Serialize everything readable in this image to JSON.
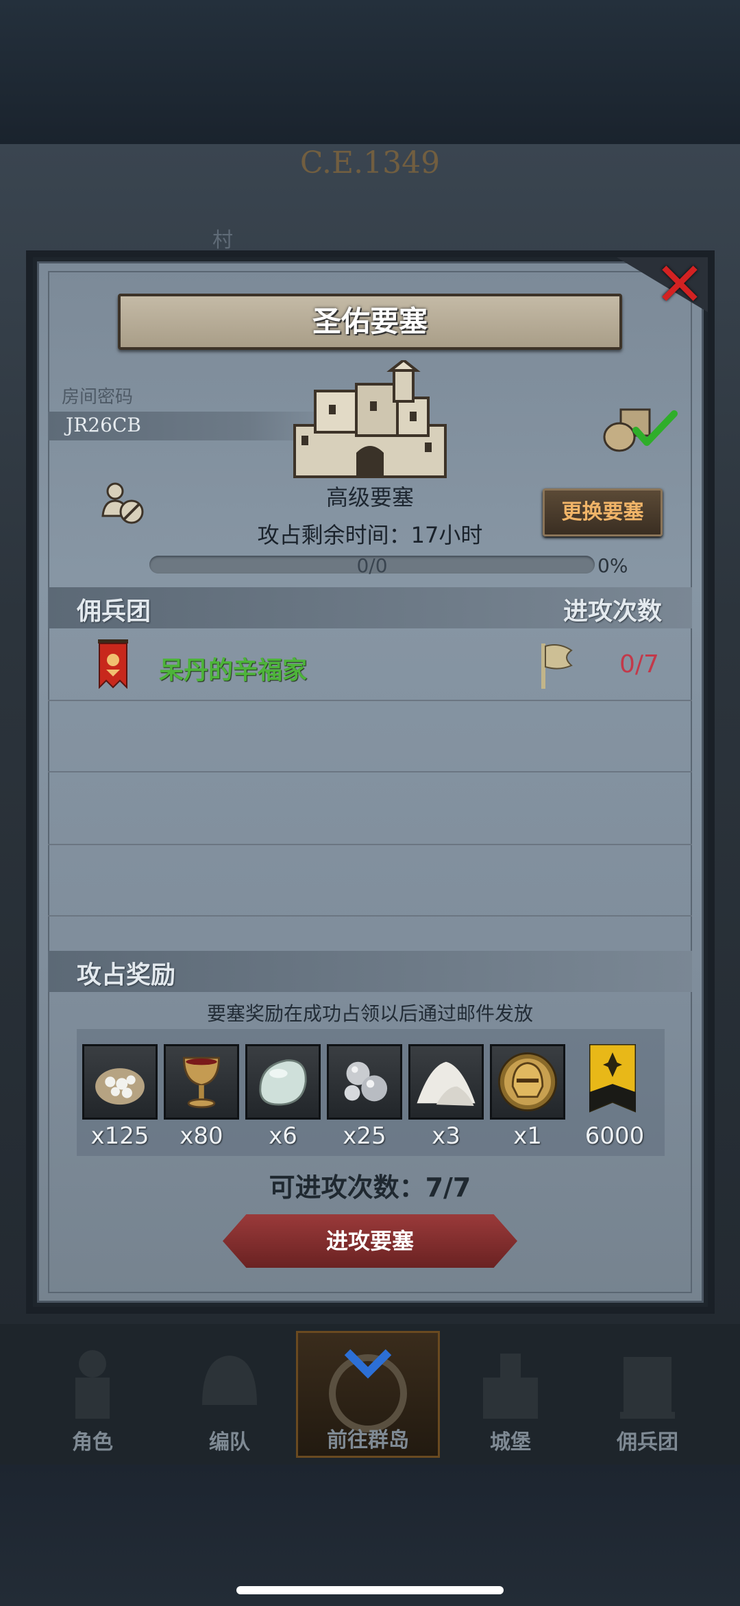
{
  "background": {
    "year": "C.E.1349",
    "village": "村"
  },
  "dialog": {
    "title": "圣佑要塞",
    "room_label": "房间密码",
    "room_code": "JR26CB",
    "fortress_type": "高级要塞",
    "timer_label": "攻占剩余时间：17小时",
    "change_button": "更换要塞",
    "progress_text": "0/0",
    "progress_percent": "0%",
    "progress_value": 0
  },
  "mercenary": {
    "header_left": "佣兵团",
    "header_right": "进攻次数",
    "rows": [
      {
        "name": "呆丹的辛福家",
        "attacks": "0/7"
      }
    ]
  },
  "rewards": {
    "header": "攻占奖励",
    "note": "要塞奖励在成功占领以后通过邮件发放",
    "items": [
      {
        "icon": "flour-sack-icon",
        "qty": "x125"
      },
      {
        "icon": "goblet-icon",
        "qty": "x80"
      },
      {
        "icon": "white-stone-icon",
        "qty": "x6"
      },
      {
        "icon": "silver-nuggets-icon",
        "qty": "x25"
      },
      {
        "icon": "salt-pile-icon",
        "qty": "x3"
      },
      {
        "icon": "golden-helmet-icon",
        "qty": "x1"
      },
      {
        "icon": "honor-banner-icon",
        "qty": "6000"
      }
    ],
    "remaining_attacks": "可进攻次数：7/7",
    "attack_button": "进攻要塞"
  },
  "nav": {
    "items": [
      {
        "label": "角色"
      },
      {
        "label": "编队"
      },
      {
        "label": "前往群岛"
      },
      {
        "label": "城堡"
      },
      {
        "label": "佣兵团"
      }
    ]
  },
  "colors": {
    "guild_name": "#4db33a",
    "attacks_count": "#c2394a",
    "change_button_text": "#f0b468",
    "close_icon": "#d32222"
  }
}
